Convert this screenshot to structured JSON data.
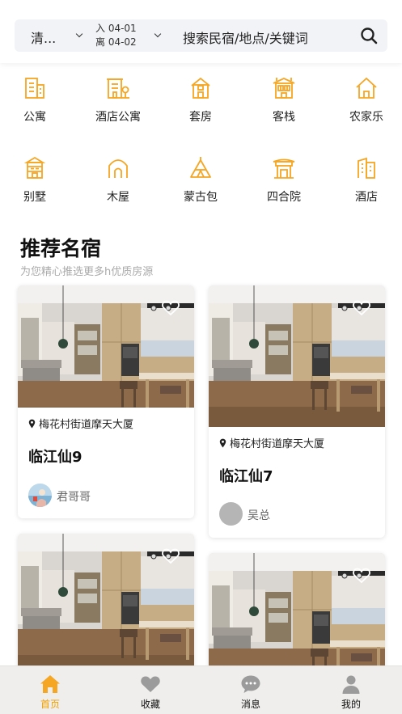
{
  "search": {
    "city": "清...",
    "checkin": "入 04-01",
    "checkout": "离 04-02",
    "placeholder": "搜索民宿/地点/关键词"
  },
  "categories": [
    {
      "label": "公寓",
      "icon": "apartment-icon"
    },
    {
      "label": "酒店公寓",
      "icon": "hotel-apartment-icon"
    },
    {
      "label": "套房",
      "icon": "suite-icon"
    },
    {
      "label": "客栈",
      "icon": "inn-icon"
    },
    {
      "label": "农家乐",
      "icon": "farmhouse-icon"
    },
    {
      "label": "别墅",
      "icon": "villa-icon"
    },
    {
      "label": "木屋",
      "icon": "cabin-icon"
    },
    {
      "label": "蒙古包",
      "icon": "yurt-icon"
    },
    {
      "label": "四合院",
      "icon": "courtyard-icon"
    },
    {
      "label": "酒店",
      "icon": "hotel-icon"
    }
  ],
  "section": {
    "title": "推荐名宿",
    "subtitle": "为您精心推选更多h优质房源"
  },
  "listings": [
    {
      "location": "梅花村街道摩天大厦",
      "name": "临江仙9",
      "host": "君哥哥"
    },
    {
      "location": "梅花村街道摩天大厦",
      "name": "临江仙7",
      "host": "吴总"
    }
  ],
  "tabs": [
    {
      "label": "首页",
      "icon": "home-icon",
      "active": true
    },
    {
      "label": "收藏",
      "icon": "heart-icon",
      "active": false
    },
    {
      "label": "消息",
      "icon": "message-icon",
      "active": false
    },
    {
      "label": "我的",
      "icon": "user-icon",
      "active": false
    }
  ],
  "colors": {
    "accent": "#f5a623",
    "tab_active": "#f0a000",
    "search_bg": "#f2f3f7"
  }
}
